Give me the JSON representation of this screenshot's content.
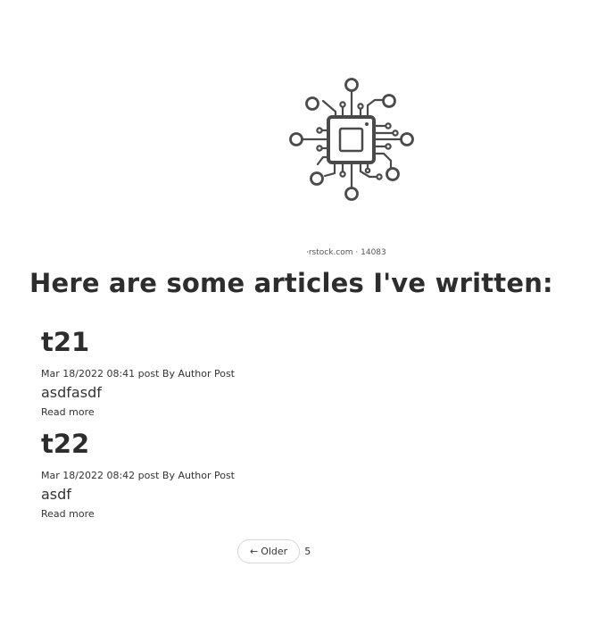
{
  "hero": {
    "icon": "circuit-chip-icon",
    "watermark": "·rstock.com · 14083"
  },
  "heading": "Here are some articles I've written:",
  "articles": [
    {
      "title": "t21",
      "meta": "Mar 18/2022 08:41 post By Author Post",
      "excerpt": "asdfasdf",
      "read_more": "Read more"
    },
    {
      "title": "t22",
      "meta": "Mar 18/2022 08:42 post By Author Post",
      "excerpt": "asdf",
      "read_more": "Read more"
    }
  ],
  "pagination": {
    "older_arrow": "←",
    "older_label": "Older",
    "page": "5"
  }
}
